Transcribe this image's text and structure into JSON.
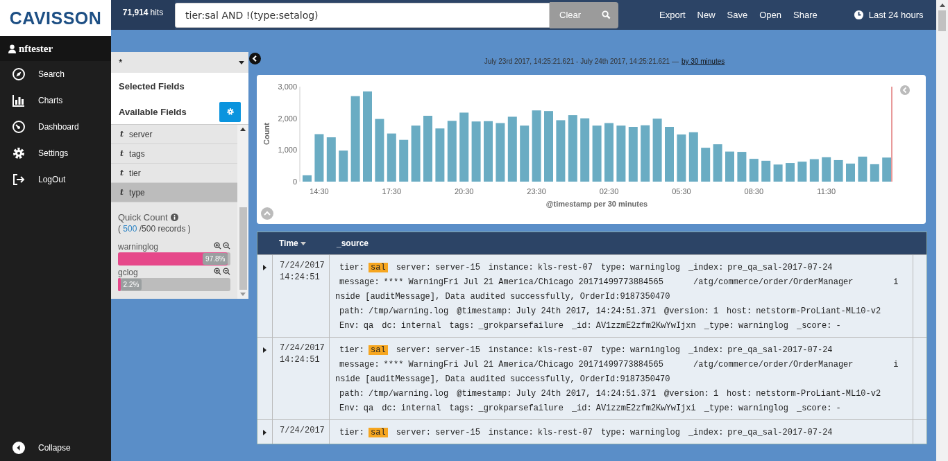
{
  "brand": {
    "logo": "CAVISSON"
  },
  "user": "nftester",
  "nav": [
    {
      "label": "Search",
      "kind": "compass"
    },
    {
      "label": "Charts",
      "kind": "chart"
    },
    {
      "label": "Dashboard",
      "kind": "gauge"
    },
    {
      "label": "Settings",
      "kind": "gear"
    },
    {
      "label": "LogOut",
      "kind": "logout"
    }
  ],
  "collapse": "Collapse",
  "topbar": {
    "hits_count": "71,914",
    "hits_label": "hits",
    "query": "tier:sal AND !(type:setalog)",
    "clear": "Clear",
    "menu": [
      "Export",
      "New",
      "Save",
      "Open",
      "Share"
    ],
    "time_range": "Last 24 hours"
  },
  "fields_panel": {
    "index": "*",
    "selected_fields": "Selected Fields",
    "available_fields": "Available Fields",
    "fields": [
      {
        "type": "t",
        "name": "server",
        "selected": false
      },
      {
        "type": "t",
        "name": "tags",
        "selected": false
      },
      {
        "type": "t",
        "name": "tier",
        "selected": false
      },
      {
        "type": "t",
        "name": "type",
        "selected": true
      }
    ],
    "quick_count": {
      "title": "Quick Count",
      "open": "(",
      "shown": "500",
      "rest": "/500 records )",
      "values": [
        {
          "name": "warninglog",
          "level": 0.978,
          "percent": "97.8%"
        },
        {
          "name": "gclog",
          "level": 0.022,
          "percent": "2.2%"
        }
      ]
    }
  },
  "range": {
    "text": "July 23rd 2017, 14:25:21.621 - July 24th 2017, 14:25:21.621 —",
    "interval": "by 30 minutes"
  },
  "histogram": {
    "chart_data": {
      "type": "bar",
      "xlabel": "@timestamp per 30 minutes",
      "ylabel": "Count",
      "x": [
        "2017-07-23T14:00",
        "2017-07-23T14:30",
        "2017-07-23T15:00",
        "2017-07-23T15:30",
        "2017-07-23T16:00",
        "2017-07-23T16:30",
        "2017-07-23T17:00",
        "2017-07-23T17:30",
        "2017-07-23T18:00",
        "2017-07-23T18:30",
        "2017-07-23T19:00",
        "2017-07-23T19:30",
        "2017-07-23T20:00",
        "2017-07-23T20:30",
        "2017-07-23T21:00",
        "2017-07-23T21:30",
        "2017-07-23T22:00",
        "2017-07-23T22:30",
        "2017-07-23T23:00",
        "2017-07-23T23:30",
        "2017-07-24T00:00",
        "2017-07-24T00:30",
        "2017-07-24T01:00",
        "2017-07-24T01:30",
        "2017-07-24T02:00",
        "2017-07-24T02:30",
        "2017-07-24T03:00",
        "2017-07-24T03:30",
        "2017-07-24T04:00",
        "2017-07-24T04:30",
        "2017-07-24T05:00",
        "2017-07-24T05:30",
        "2017-07-24T06:00",
        "2017-07-24T06:30",
        "2017-07-24T07:00",
        "2017-07-24T07:30",
        "2017-07-24T08:00",
        "2017-07-24T08:30",
        "2017-07-24T09:00",
        "2017-07-24T09:30",
        "2017-07-24T10:00",
        "2017-07-24T10:30",
        "2017-07-24T11:00",
        "2017-07-24T11:30",
        "2017-07-24T12:00",
        "2017-07-24T12:30",
        "2017-07-24T13:00",
        "2017-07-24T13:30",
        "2017-07-24T14:00"
      ],
      "xlim": [
        "2017-07-23T14:00",
        "2017-07-24T14:00"
      ],
      "values": [
        200,
        1500,
        1400,
        980,
        2700,
        2850,
        1980,
        1520,
        1320,
        1770,
        2080,
        1680,
        1920,
        2180,
        1900,
        1910,
        1850,
        2050,
        1770,
        2250,
        2230,
        1940,
        2100,
        2000,
        1770,
        1850,
        1770,
        1730,
        1780,
        1990,
        1730,
        1490,
        1560,
        1070,
        1180,
        950,
        940,
        720,
        660,
        540,
        590,
        630,
        710,
        770,
        680,
        570,
        790,
        550,
        760
      ],
      "ylim": [
        0,
        3000
      ],
      "yticks": [
        {
          "value": 0,
          "label": "0"
        },
        {
          "value": 1000,
          "label": "1,000"
        },
        {
          "value": 2000,
          "label": "2,000"
        },
        {
          "value": 3000,
          "label": "3,000"
        }
      ],
      "xticks": [
        {
          "value": "2017-07-23T14:30",
          "label": "14:30"
        },
        {
          "value": "2017-07-23T17:30",
          "label": "17:30"
        },
        {
          "value": "2017-07-23T20:30",
          "label": "20:30"
        },
        {
          "value": "2017-07-23T23:30",
          "label": "23:30"
        },
        {
          "value": "2017-07-24T02:30",
          "label": "02:30"
        },
        {
          "value": "2017-07-24T05:30",
          "label": "05:30"
        },
        {
          "value": "2017-07-24T08:30",
          "label": "08:30"
        },
        {
          "value": "2017-07-24T11:30",
          "label": "11:30"
        }
      ]
    }
  },
  "table": {
    "columns": [
      {
        "label": "Time",
        "sorted": true
      },
      {
        "label": "_source",
        "sorted": false
      }
    ],
    "rows": [
      {
        "time": [
          "7/24/2017",
          "14:24:51"
        ],
        "lines": [
          {
            "kind": "pairs",
            "pairs": [
              {
                "key": "tier:",
                "value": "sal",
                "highlighted": true
              },
              {
                "key": "server:",
                "value": "server-15",
                "highlighted": false
              },
              {
                "key": "instance:",
                "value": "kls-rest-07",
                "highlighted": false
              },
              {
                "key": "type:",
                "value": "warninglog",
                "highlighted": false
              },
              {
                "key": "_index:",
                "value": "pre_qa_sal-2017-07-24",
                "highlighted": false
              }
            ]
          },
          {
            "kind": "pairs",
            "pairs": [
              {
                "key": "message:",
                "value": "**** WarningFri Jul 21 America/Chicago 20171499773884565      /atg/commerce/order/OrderManager        i",
                "highlighted": false
              }
            ]
          },
          {
            "kind": "text",
            "text": "nside [auditMessage], Data audited successfully, OrderId:9187350470"
          },
          {
            "kind": "pairs",
            "pairs": [
              {
                "key": "path:",
                "value": "/tmp/warning.log",
                "highlighted": false
              },
              {
                "key": "@timestamp:",
                "value": "July 24th 2017, 14:24:51.371",
                "highlighted": false
              },
              {
                "key": "@version:",
                "value": "1",
                "highlighted": false
              },
              {
                "key": "host:",
                "value": "netstorm-ProLiant-ML10-v2",
                "highlighted": false
              }
            ]
          },
          {
            "kind": "pairs",
            "pairs": [
              {
                "key": "Env:",
                "value": "qa",
                "highlighted": false
              },
              {
                "key": "dc:",
                "value": "internal",
                "highlighted": false
              },
              {
                "key": "tags:",
                "value": "_grokparsefailure",
                "highlighted": false
              },
              {
                "key": "_id:",
                "value": "AV1zzmE2zfm2KwYwIjxn",
                "highlighted": false
              },
              {
                "key": "_type:",
                "value": "warninglog",
                "highlighted": false
              },
              {
                "key": "_score:",
                "value": "-",
                "highlighted": false
              }
            ]
          }
        ]
      },
      {
        "time": [
          "7/24/2017",
          "14:24:51"
        ],
        "lines": [
          {
            "kind": "pairs",
            "pairs": [
              {
                "key": "tier:",
                "value": "sal",
                "highlighted": true
              },
              {
                "key": "server:",
                "value": "server-15",
                "highlighted": false
              },
              {
                "key": "instance:",
                "value": "kls-rest-07",
                "highlighted": false
              },
              {
                "key": "type:",
                "value": "warninglog",
                "highlighted": false
              },
              {
                "key": "_index:",
                "value": "pre_qa_sal-2017-07-24",
                "highlighted": false
              }
            ]
          },
          {
            "kind": "pairs",
            "pairs": [
              {
                "key": "message:",
                "value": "**** WarningFri Jul 21 America/Chicago 20171499773884565      /atg/commerce/order/OrderManager        i",
                "highlighted": false
              }
            ]
          },
          {
            "kind": "text",
            "text": "nside [auditMessage], Data audited successfully, OrderId:9187350470"
          },
          {
            "kind": "pairs",
            "pairs": [
              {
                "key": "path:",
                "value": "/tmp/warning.log",
                "highlighted": false
              },
              {
                "key": "@timestamp:",
                "value": "July 24th 2017, 14:24:51.371",
                "highlighted": false
              },
              {
                "key": "@version:",
                "value": "1",
                "highlighted": false
              },
              {
                "key": "host:",
                "value": "netstorm-ProLiant-ML10-v2",
                "highlighted": false
              }
            ]
          },
          {
            "kind": "pairs",
            "pairs": [
              {
                "key": "Env:",
                "value": "qa",
                "highlighted": false
              },
              {
                "key": "dc:",
                "value": "internal",
                "highlighted": false
              },
              {
                "key": "tags:",
                "value": "_grokparsefailure",
                "highlighted": false
              },
              {
                "key": "_id:",
                "value": "AV1zzmE2zfm2KwYwIjxi",
                "highlighted": false
              },
              {
                "key": "_type:",
                "value": "warninglog",
                "highlighted": false
              },
              {
                "key": "_score:",
                "value": "-",
                "highlighted": false
              }
            ]
          }
        ]
      },
      {
        "time": [
          "7/24/2017"
        ],
        "lines": [
          {
            "kind": "pairs",
            "pairs": [
              {
                "key": "tier:",
                "value": "sal",
                "highlighted": true
              },
              {
                "key": "server:",
                "value": "server-15",
                "highlighted": false
              },
              {
                "key": "instance:",
                "value": "kls-rest-07",
                "highlighted": false
              },
              {
                "key": "type:",
                "value": "warninglog",
                "highlighted": false
              },
              {
                "key": "_index:",
                "value": "pre_qa_sal-2017-07-24",
                "highlighted": false
              }
            ]
          }
        ]
      }
    ]
  }
}
